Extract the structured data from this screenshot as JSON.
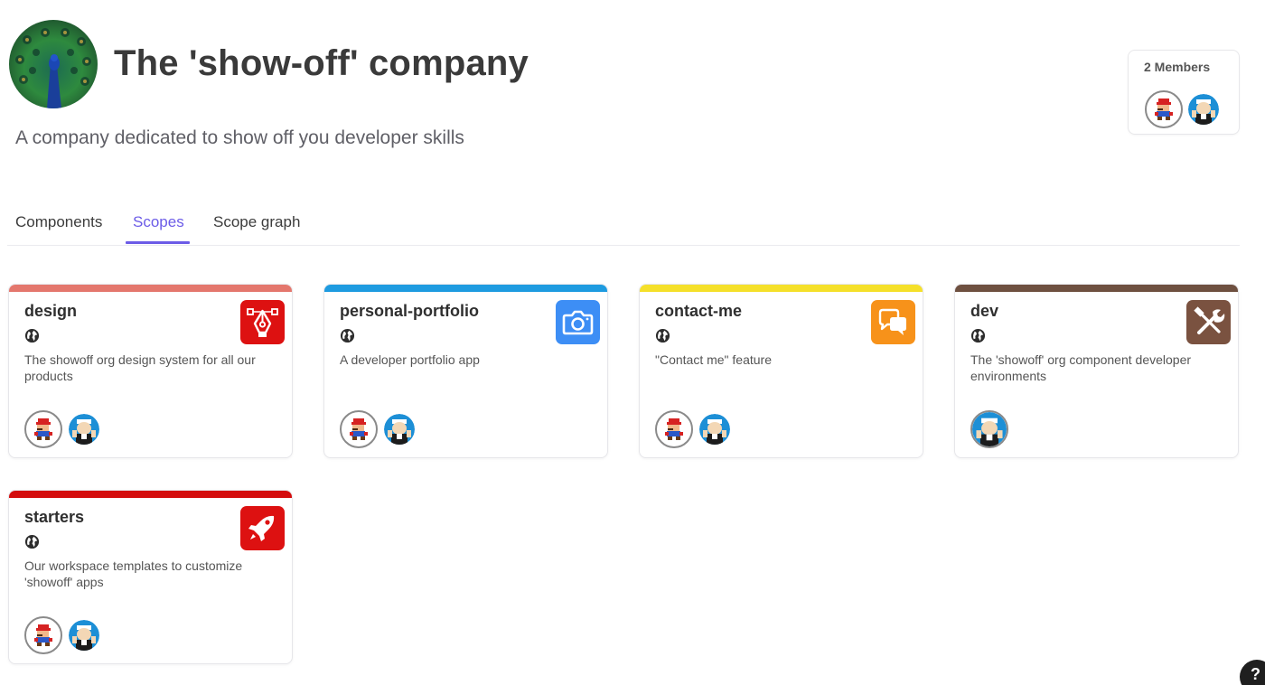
{
  "org": {
    "title": "The 'show-off' company",
    "description": "A company dedicated to show off you developer skills",
    "avatar_icon": "peacock-avatar"
  },
  "members": {
    "label": "2 Members",
    "avatars": [
      "mario-avatar",
      "popeye-avatar"
    ]
  },
  "tabs": [
    {
      "label": "Components",
      "active": false
    },
    {
      "label": "Scopes",
      "active": true
    },
    {
      "label": "Scope graph",
      "active": false
    }
  ],
  "accent_color": "#6c5ce7",
  "scopes": [
    {
      "name": "design",
      "description": "The showoff org design system for all our products",
      "color": "#e4776d",
      "icon": "pen-tool-icon",
      "icon_color": "#dd1111",
      "members": [
        "mario-avatar",
        "popeye-avatar"
      ]
    },
    {
      "name": "personal-portfolio",
      "description": "A developer portfolio app",
      "color": "#1e9be0",
      "icon": "camera-icon",
      "icon_color": "#3d8ef5",
      "members": [
        "mario-avatar",
        "popeye-avatar"
      ]
    },
    {
      "name": "contact-me",
      "description": "\"Contact me\" feature",
      "color": "#f5e02a",
      "icon": "chat-bubbles-icon",
      "icon_color": "#f7921a",
      "members": [
        "mario-avatar",
        "popeye-avatar"
      ]
    },
    {
      "name": "dev",
      "description": "The 'showoff' org component developer environments",
      "color": "#6e5040",
      "icon": "tools-icon",
      "icon_color": "#7a5240",
      "members": [
        "popeye-avatar"
      ]
    },
    {
      "name": "starters",
      "description": "Our workspace templates to customize 'showoff' apps",
      "color": "#d40d0d",
      "icon": "rocket-icon",
      "icon_color": "#dd1111",
      "members": [
        "mario-avatar",
        "popeye-avatar"
      ]
    }
  ],
  "help": {
    "label": "?"
  }
}
